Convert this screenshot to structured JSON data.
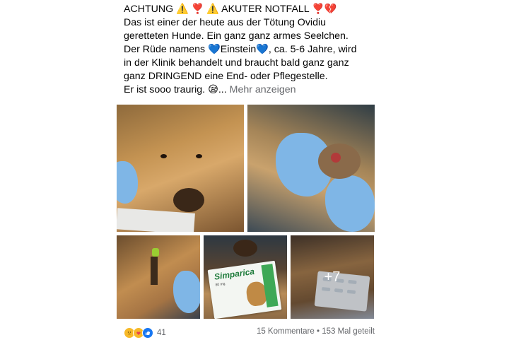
{
  "post": {
    "lines": [
      "ACHTUNG ⚠️ ❣️ ⚠️ AKUTER NOTFALL ❣️💔",
      "Das ist einer der heute aus der Tötung Ovidiu",
      "geretteten Hunde. Ein ganz ganz armes Seelchen.",
      "Der Rüde namens 💙Einstein💙, ca. 5-6 Jahre,  wird",
      "in der Klinik behandelt und braucht bald ganz ganz",
      "ganz DRINGEND eine End- oder Pflegestelle.",
      "Er ist sooo traurig. 😪..."
    ],
    "more_label": "Mehr anzeigen"
  },
  "photos": {
    "overflow_count": "+7",
    "medicine_brand": "Simparica",
    "medicine_dose": "80 mg"
  },
  "footer": {
    "reaction_count": "41",
    "comments": "15 Kommentare",
    "separator": "•",
    "shares": "153 Mal geteilt"
  },
  "icons": {
    "reactions": [
      "sad-reaction-icon",
      "care-reaction-icon",
      "like-reaction-icon"
    ]
  },
  "colors": {
    "text": "#050505",
    "secondary": "#65676b",
    "like_blue": "#1877f2",
    "reaction_yellow": "#f7b928"
  }
}
